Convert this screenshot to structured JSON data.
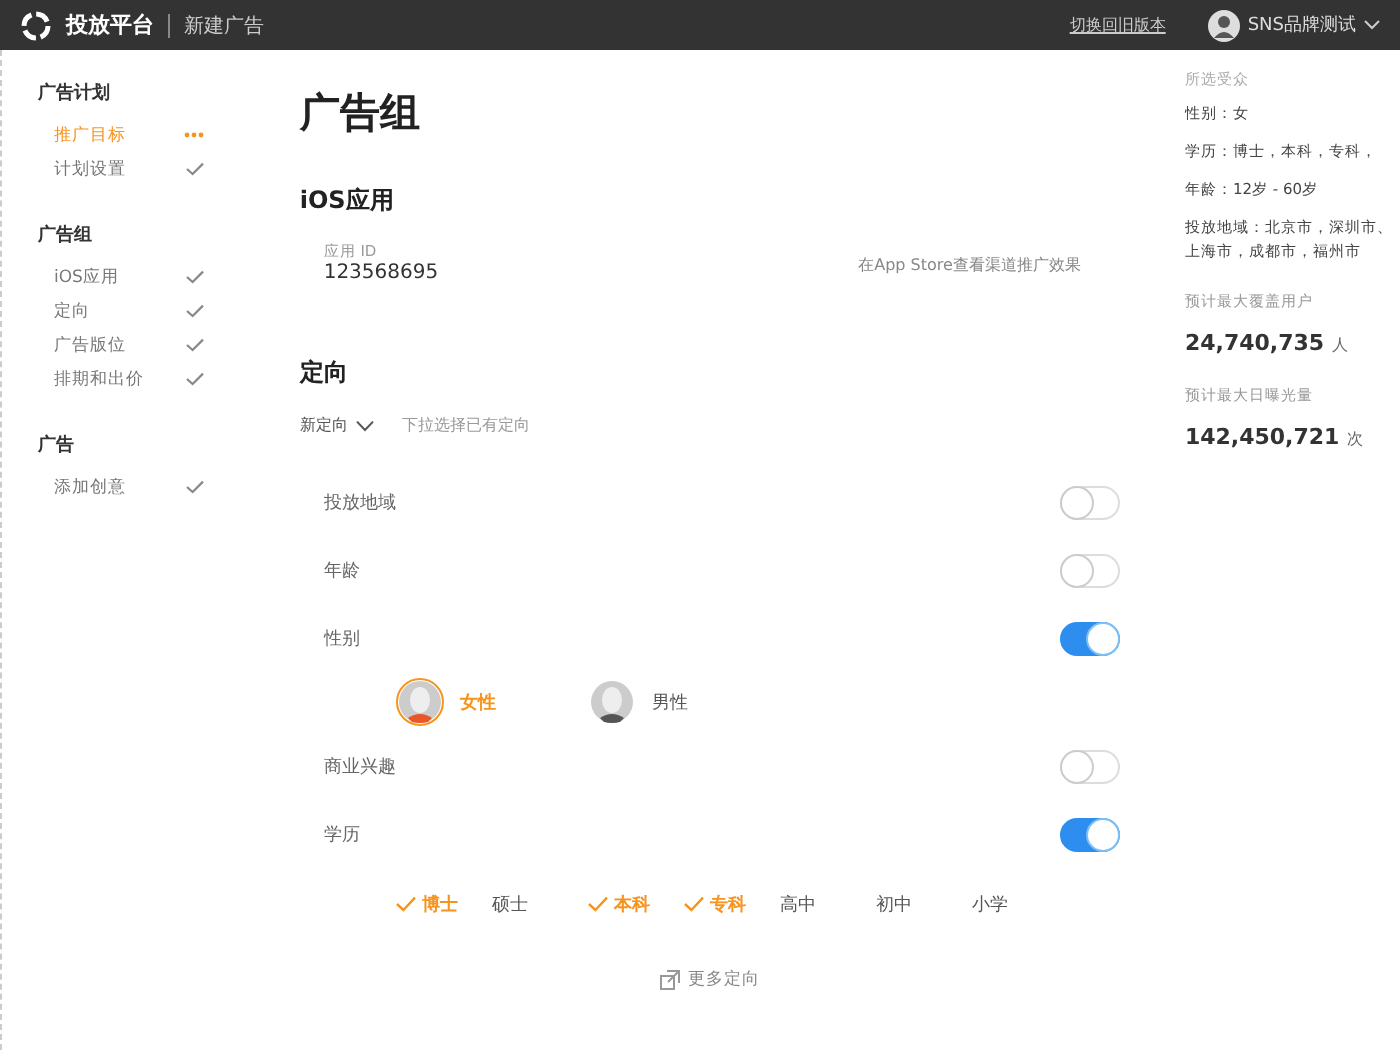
{
  "header": {
    "brand": "投放平台",
    "page_title": "新建广告",
    "old_version_link": "切换回旧版本",
    "user_name": "SNS品牌测试"
  },
  "sidebar": {
    "groups": [
      {
        "title": "广告计划",
        "items": [
          {
            "label": "推广目标",
            "selected": true,
            "completed": false
          },
          {
            "label": "计划设置",
            "selected": false,
            "completed": true
          }
        ]
      },
      {
        "title": "广告组",
        "items": [
          {
            "label": "iOS应用",
            "selected": false,
            "completed": true
          },
          {
            "label": "定向",
            "selected": false,
            "completed": true
          },
          {
            "label": "广告版位",
            "selected": false,
            "completed": true
          },
          {
            "label": "排期和出价",
            "selected": false,
            "completed": true
          }
        ]
      },
      {
        "title": "广告",
        "items": [
          {
            "label": "添加创意",
            "selected": false,
            "completed": true
          }
        ]
      }
    ]
  },
  "page_title": "广告组",
  "ios_app": {
    "title": "iOS应用",
    "id_label": "应用 ID",
    "id_value": "123568695",
    "preview_link": "在App Store查看渠道推广效果"
  },
  "targeting": {
    "title": "定向",
    "preset_select": "新定向",
    "preset_hint": "下拉选择已有定向",
    "rows": [
      {
        "label": "投放地域",
        "on": false
      },
      {
        "label": "年龄",
        "on": false
      },
      {
        "label": "性别",
        "on": true,
        "kind": "gender",
        "options": [
          {
            "label": "女性",
            "selected": true
          },
          {
            "label": "男性",
            "selected": false
          }
        ]
      },
      {
        "label": "商业兴趣",
        "on": false
      },
      {
        "label": "学历",
        "on": true,
        "kind": "checks",
        "options": [
          {
            "label": "博士",
            "checked": true
          },
          {
            "label": "硕士",
            "checked": false
          },
          {
            "label": "本科",
            "checked": true
          },
          {
            "label": "专科",
            "checked": true
          },
          {
            "label": "高中",
            "checked": false
          },
          {
            "label": "初中",
            "checked": false
          },
          {
            "label": "小学",
            "checked": false
          }
        ]
      }
    ],
    "more_link": "更多定向"
  },
  "summary": {
    "title": "所选受众",
    "lines": [
      "性别：女",
      "学历：博士，本科，专科，",
      "年龄：12岁 - 60岁",
      "投放地域：北京市，深圳市、上海市，成都市，福州市"
    ],
    "stats": [
      {
        "label": "预计最大覆盖用户",
        "value": "24,740,735",
        "unit": "人"
      },
      {
        "label": "预计最大日曝光量",
        "value": "142,450,721",
        "unit": "次"
      }
    ]
  }
}
